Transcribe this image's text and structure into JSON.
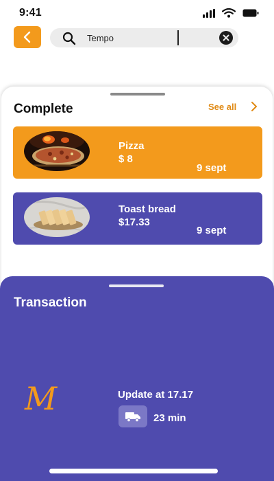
{
  "status_bar": {
    "time": "9:41"
  },
  "search": {
    "value": "Tempo"
  },
  "complete": {
    "title": "Complete",
    "see_all": "See all",
    "items": [
      {
        "title": "Pizza",
        "price": "$ 8",
        "date": "9 sept",
        "color": "#F39A1C"
      },
      {
        "title": "Toast bread",
        "price": "$17.33",
        "date": "9 sept",
        "color": "#4F4BAE"
      }
    ]
  },
  "transaction": {
    "title": "Transaction",
    "logo": "M",
    "update": "Update at 17.17",
    "eta": "23 min",
    "color": "#4F4BAE"
  },
  "icons": [
    "signal-icon",
    "wifi-icon",
    "battery-icon",
    "back-arrow-icon",
    "search-icon",
    "clear-icon",
    "chevron-right-icon",
    "truck-icon"
  ]
}
